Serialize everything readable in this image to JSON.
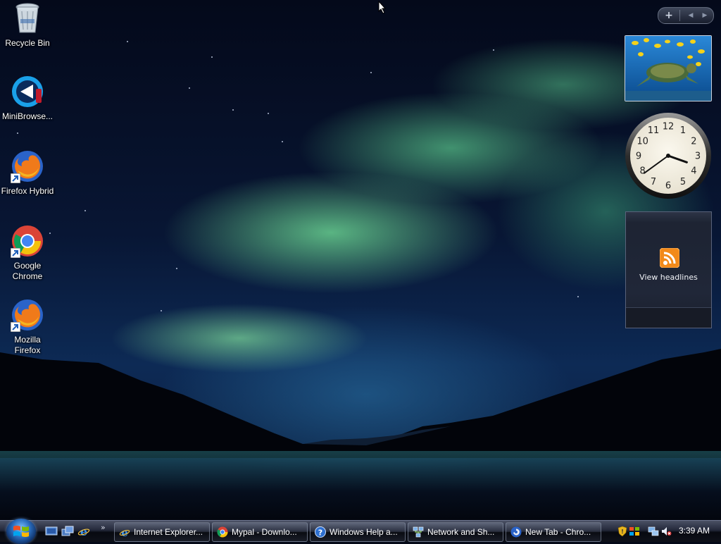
{
  "desktop": {
    "icons": [
      {
        "label": "Recycle Bin",
        "icon": "recycle-bin-icon"
      },
      {
        "label": "MiniBrowse...",
        "icon": "minibrowser-icon"
      },
      {
        "label": "Firefox Hybrid",
        "icon": "firefox-icon"
      },
      {
        "label": "Google Chrome",
        "icon": "chrome-icon"
      },
      {
        "label": "Mozilla Firefox",
        "icon": "firefox-icon"
      }
    ]
  },
  "sidebar": {
    "controls": {
      "add": "+",
      "prev": "◀",
      "next": "▶"
    },
    "slideshow": {
      "subject": "sea-turtle-photo"
    },
    "clock": {
      "hour": 3,
      "minute": 39,
      "numerals": [
        "12",
        "1",
        "2",
        "3",
        "4",
        "5",
        "6",
        "7",
        "8",
        "9",
        "10",
        "11"
      ]
    },
    "feed": {
      "label": "View headlines",
      "icon": "rss-icon",
      "accent": "#f28a1a"
    }
  },
  "taskbar": {
    "quick_launch": [
      {
        "icon": "show-desktop-icon"
      },
      {
        "icon": "switch-windows-icon"
      },
      {
        "icon": "internet-explorer-icon"
      }
    ],
    "quick_launch_more": "»",
    "tasks": [
      {
        "label": "Internet Explorer...",
        "icon": "internet-explorer-icon"
      },
      {
        "label": "Mypal - Downlo...",
        "icon": "chrome-icon"
      },
      {
        "label": "Windows Help a...",
        "icon": "help-icon"
      },
      {
        "label": "Network and Sh...",
        "icon": "network-icon"
      },
      {
        "label": "New Tab - Chro...",
        "icon": "browser-icon"
      }
    ],
    "tray": [
      {
        "icon": "security-shield-icon"
      },
      {
        "icon": "windows-update-icon"
      },
      {
        "icon": "network-status-icon"
      },
      {
        "icon": "volume-muted-icon"
      }
    ],
    "clock": "3:39 AM"
  },
  "colors": {
    "accent": "#2c6fc0",
    "aurora": "#6ed79a",
    "taskbar": "#1a1e2a"
  }
}
